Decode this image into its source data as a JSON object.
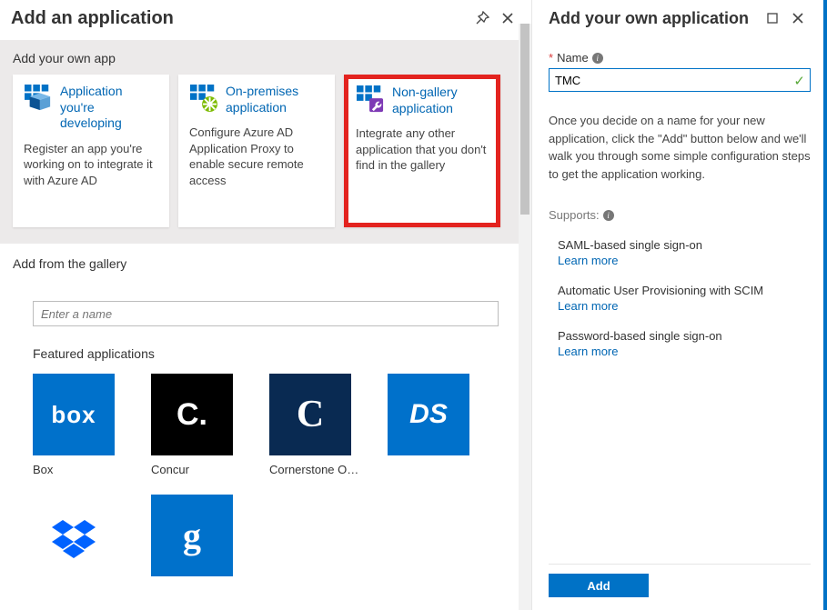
{
  "left": {
    "title": "Add an application",
    "ownAppLabel": "Add your own app",
    "cards": [
      {
        "title": "Application you're developing",
        "desc": "Register an app you're working on to integrate it with Azure AD"
      },
      {
        "title": "On-premises application",
        "desc": "Configure Azure AD Application Proxy to enable secure remote access"
      },
      {
        "title": "Non-gallery application",
        "desc": "Integrate any other application that you don't find in the gallery"
      }
    ],
    "galleryLabel": "Add from the gallery",
    "searchPlaceholder": "Enter a name",
    "featuredLabel": "Featured applications",
    "tiles": [
      {
        "label": "Box",
        "glyph": "box",
        "cls": "c-box"
      },
      {
        "label": "Concur",
        "glyph": "C.",
        "cls": "c-concur"
      },
      {
        "label": "Cornerstone O…",
        "glyph": "C",
        "cls": "c-corner"
      },
      {
        "label": "",
        "glyph": "DS",
        "cls": "c-ds"
      },
      {
        "label": "",
        "glyph": "db",
        "cls": "c-dropbox"
      },
      {
        "label": "",
        "glyph": "g",
        "cls": "c-google"
      }
    ]
  },
  "right": {
    "title": "Add your own application",
    "nameLabel": "Name",
    "nameValue": "TMC",
    "helpText": "Once you decide on a name for your new application, click the \"Add\" button below and we'll walk you through some simple configuration steps to get the application working.",
    "supportsLabel": "Supports:",
    "supports": [
      {
        "title": "SAML-based single sign-on",
        "link": "Learn more"
      },
      {
        "title": "Automatic User Provisioning with SCIM",
        "link": "Learn more"
      },
      {
        "title": "Password-based single sign-on",
        "link": "Learn more"
      }
    ],
    "addLabel": "Add"
  }
}
